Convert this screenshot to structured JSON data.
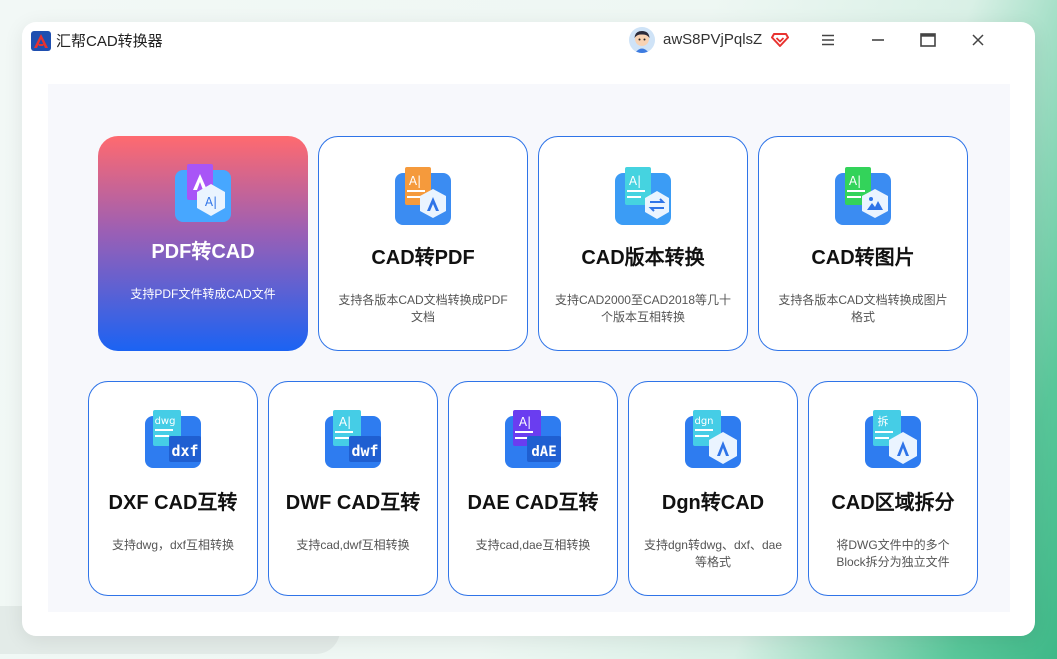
{
  "app": {
    "title": "汇帮CAD转换器",
    "username": "awS8PVjPqlsZ"
  },
  "colors": {
    "accent": "#2f74e8",
    "active_gradient_top": "#ff6a6f",
    "active_gradient_bottom": "#1b63f3"
  },
  "cards": [
    {
      "title": "PDF转CAD",
      "desc": "支持PDF文件转成CAD文件",
      "icon": "pdf-to-cad-icon",
      "active": true
    },
    {
      "title": "CAD转PDF",
      "desc": "支持各版本CAD文档转换成PDF文档",
      "icon": "cad-to-pdf-icon"
    },
    {
      "title": "CAD版本转换",
      "desc": "支持CAD2000至CAD2018等几十个版本互相转换",
      "icon": "cad-version-icon"
    },
    {
      "title": "CAD转图片",
      "desc": "支持各版本CAD文档转换成图片格式",
      "icon": "cad-to-image-icon"
    },
    {
      "title": "DXF CAD互转",
      "desc": "支持dwg，dxf互相转换",
      "icon": "dxf-icon",
      "badge": "dxf",
      "tag": "dwg"
    },
    {
      "title": "DWF CAD互转",
      "desc": "支持cad,dwf互相转换",
      "icon": "dwf-icon",
      "badge": "dwf"
    },
    {
      "title": "DAE CAD互转",
      "desc": "支持cad,dae互相转换",
      "icon": "dae-icon",
      "badge": "dAE"
    },
    {
      "title": "Dgn转CAD",
      "desc": "支持dgn转dwg、dxf、dae等格式",
      "icon": "dgn-icon",
      "tag": "dgn"
    },
    {
      "title": "CAD区域拆分",
      "desc": "将DWG文件中的多个Block拆分为独立文件",
      "icon": "split-icon",
      "tag": "拆"
    }
  ]
}
